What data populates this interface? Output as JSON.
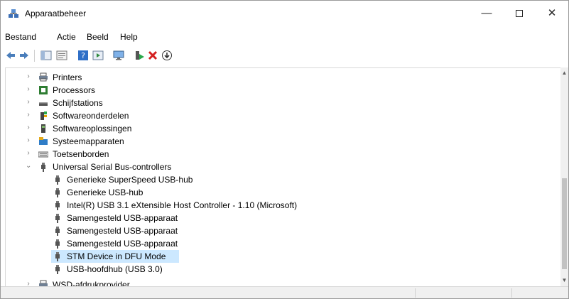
{
  "window": {
    "title": "Apparaatbeheer"
  },
  "menu": [
    "Bestand",
    "Actie",
    "Beeld",
    "Help"
  ],
  "toolbar": [
    "back-arrow-icon",
    "forward-arrow-icon",
    "console-tree-icon",
    "properties-icon",
    "help-icon",
    "action-pane-icon",
    "monitor-icon",
    "enable-device-icon",
    "uninstall-icon",
    "update-driver-icon"
  ],
  "tree": {
    "categories_top": [
      {
        "label": "Printers",
        "icon": "printer-icon"
      },
      {
        "label": "Processors",
        "icon": "processor-icon"
      },
      {
        "label": "Schijfstations",
        "icon": "disk-drive-icon"
      },
      {
        "label": "Softwareonderdelen",
        "icon": "software-component-icon"
      },
      {
        "label": "Softwareoplossingen",
        "icon": "software-device-icon"
      },
      {
        "label": "Systeemapparaten",
        "icon": "system-devices-icon"
      },
      {
        "label": "Toetsenborden",
        "icon": "keyboard-icon"
      }
    ],
    "usb": {
      "label": "Universal Serial Bus-controllers",
      "children": [
        "Generieke SuperSpeed USB-hub",
        "Generieke USB-hub",
        "Intel(R) USB 3.1 eXtensible Host Controller - 1.10 (Microsoft)",
        "Samengesteld USB-apparaat",
        "Samengesteld USB-apparaat",
        "Samengesteld USB-apparaat",
        "STM Device in DFU Mode",
        "USB-hoofdhub (USB 3.0)"
      ],
      "selected": "STM Device in DFU Mode"
    },
    "partial_category": "WSD-afdrukprovider"
  },
  "colors": {
    "selection": "#cce8ff"
  }
}
